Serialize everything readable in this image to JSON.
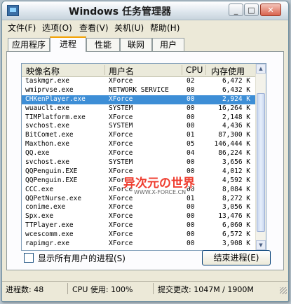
{
  "window": {
    "title": "Windows 任务管理器"
  },
  "menu": [
    {
      "label": "文件(F)"
    },
    {
      "label": "选项(O)"
    },
    {
      "label": "查看(V)"
    },
    {
      "label": "关机(U)"
    },
    {
      "label": "帮助(H)"
    }
  ],
  "tabs": [
    {
      "label": "应用程序",
      "active": false
    },
    {
      "label": "进程",
      "active": true
    },
    {
      "label": "性能",
      "active": false
    },
    {
      "label": "联网",
      "active": false
    },
    {
      "label": "用户",
      "active": false
    }
  ],
  "table": {
    "headers": [
      "映像名称",
      "用户名",
      "CPU",
      "内存使用"
    ],
    "rows": [
      {
        "name": "taskmgr.exe",
        "user": "XForce",
        "cpu": "02",
        "mem": "6,472 K"
      },
      {
        "name": "wmiprvse.exe",
        "user": "NETWORK SERVICE",
        "cpu": "00",
        "mem": "6,432 K"
      },
      {
        "name": "CHKenPlayer.exe",
        "user": "XForce",
        "cpu": "00",
        "mem": "2,924 K",
        "selected": true
      },
      {
        "name": "wuauclt.exe",
        "user": "SYSTEM",
        "cpu": "00",
        "mem": "16,264 K"
      },
      {
        "name": "TIMPlatform.exe",
        "user": "XForce",
        "cpu": "00",
        "mem": "2,148 K"
      },
      {
        "name": "svchost.exe",
        "user": "SYSTEM",
        "cpu": "00",
        "mem": "4,436 K"
      },
      {
        "name": "BitComet.exe",
        "user": "XForce",
        "cpu": "01",
        "mem": "87,300 K"
      },
      {
        "name": "Maxthon.exe",
        "user": "XForce",
        "cpu": "05",
        "mem": "146,444 K"
      },
      {
        "name": "QQ.exe",
        "user": "XForce",
        "cpu": "04",
        "mem": "86,224 K"
      },
      {
        "name": "svchost.exe",
        "user": "SYSTEM",
        "cpu": "00",
        "mem": "3,656 K"
      },
      {
        "name": "QQPenguin.EXE",
        "user": "XForce",
        "cpu": "00",
        "mem": "4,012 K"
      },
      {
        "name": "QQPenguin.EXE",
        "user": "XForce",
        "cpu": "01",
        "mem": "4,592 K"
      },
      {
        "name": "CCC.exe",
        "user": "XForce",
        "cpu": "00",
        "mem": "8,084 K"
      },
      {
        "name": "QQPetNurse.exe",
        "user": "XForce",
        "cpu": "01",
        "mem": "8,272 K"
      },
      {
        "name": "conime.exe",
        "user": "XForce",
        "cpu": "00",
        "mem": "3,056 K"
      },
      {
        "name": "Spx.exe",
        "user": "XForce",
        "cpu": "00",
        "mem": "13,476 K"
      },
      {
        "name": "TTPlayer.exe",
        "user": "XForce",
        "cpu": "00",
        "mem": "6,060 K"
      },
      {
        "name": "wcescomm.exe",
        "user": "XForce",
        "cpu": "00",
        "mem": "6,572 K"
      },
      {
        "name": "rapimgr.exe",
        "user": "XForce",
        "cpu": "00",
        "mem": "3,908 K"
      }
    ]
  },
  "watermark": {
    "text": "异次元の世界",
    "subtext": "WWW.X-FORCE.CN"
  },
  "show_all_users": {
    "label": "显示所有用户的进程(S)"
  },
  "end_process_button": {
    "label": "结束进程(E)"
  },
  "statusbar": {
    "processes": "进程数: 48",
    "cpu_usage": "CPU 使用: 100%",
    "commit_charge": "提交更改: 1047M / 1900M"
  }
}
